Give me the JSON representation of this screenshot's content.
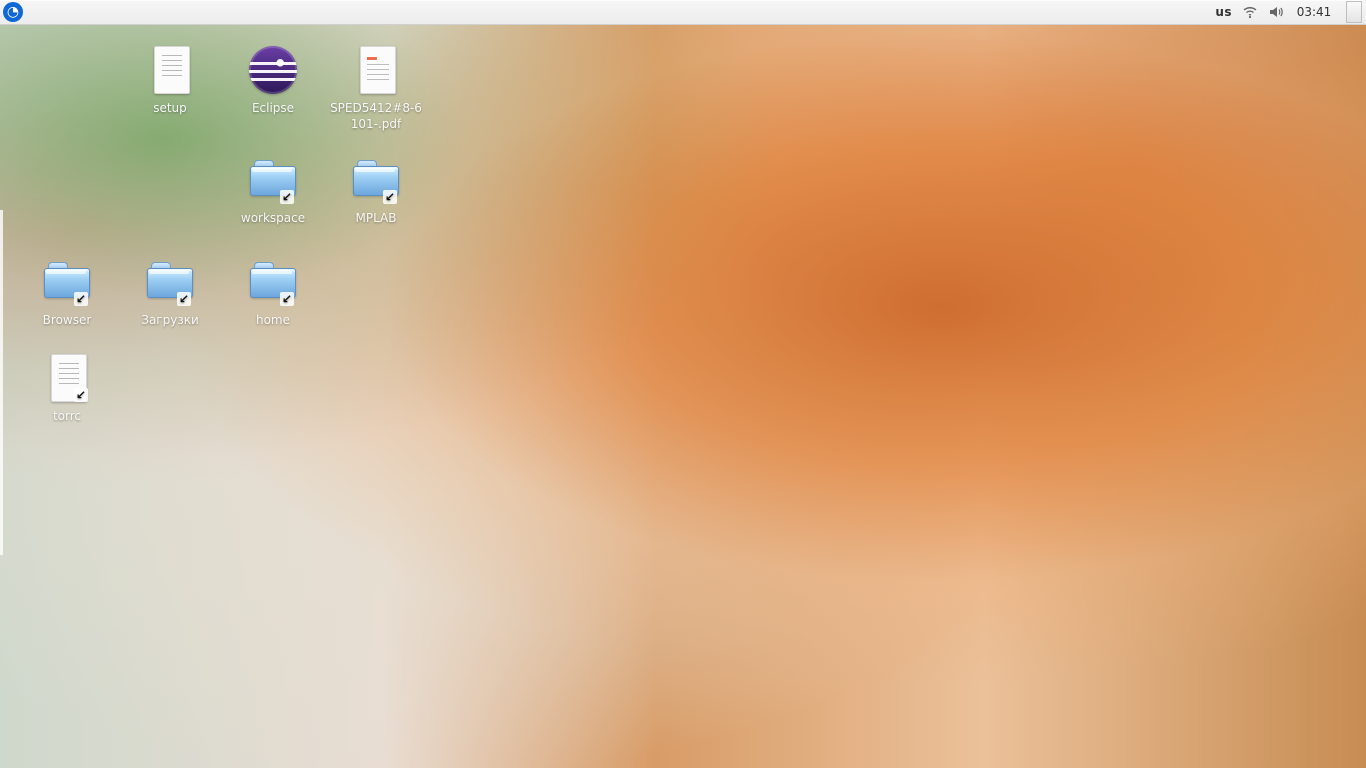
{
  "topbar": {
    "keyboard_layout": "us",
    "clock": "03:41"
  },
  "desktop": {
    "items": [
      {
        "label": "setup",
        "type": "document"
      },
      {
        "label": "Eclipse",
        "type": "eclipse"
      },
      {
        "label": "SPED5412#8-6\n101-.pdf",
        "type": "pdf"
      },
      {
        "label": "workspace",
        "type": "folder"
      },
      {
        "label": "MPLAB",
        "type": "folder"
      },
      {
        "label": "Browser",
        "type": "folder"
      },
      {
        "label": "Загрузки",
        "type": "folder"
      },
      {
        "label": "home",
        "type": "folder"
      },
      {
        "label": "torrc",
        "type": "document"
      }
    ]
  },
  "icons": {
    "menu": "xfce-menu-icon",
    "wifi": "wifi-icon",
    "volume": "volume-icon",
    "folder_shortcut": "shortcut-arrow-icon"
  }
}
